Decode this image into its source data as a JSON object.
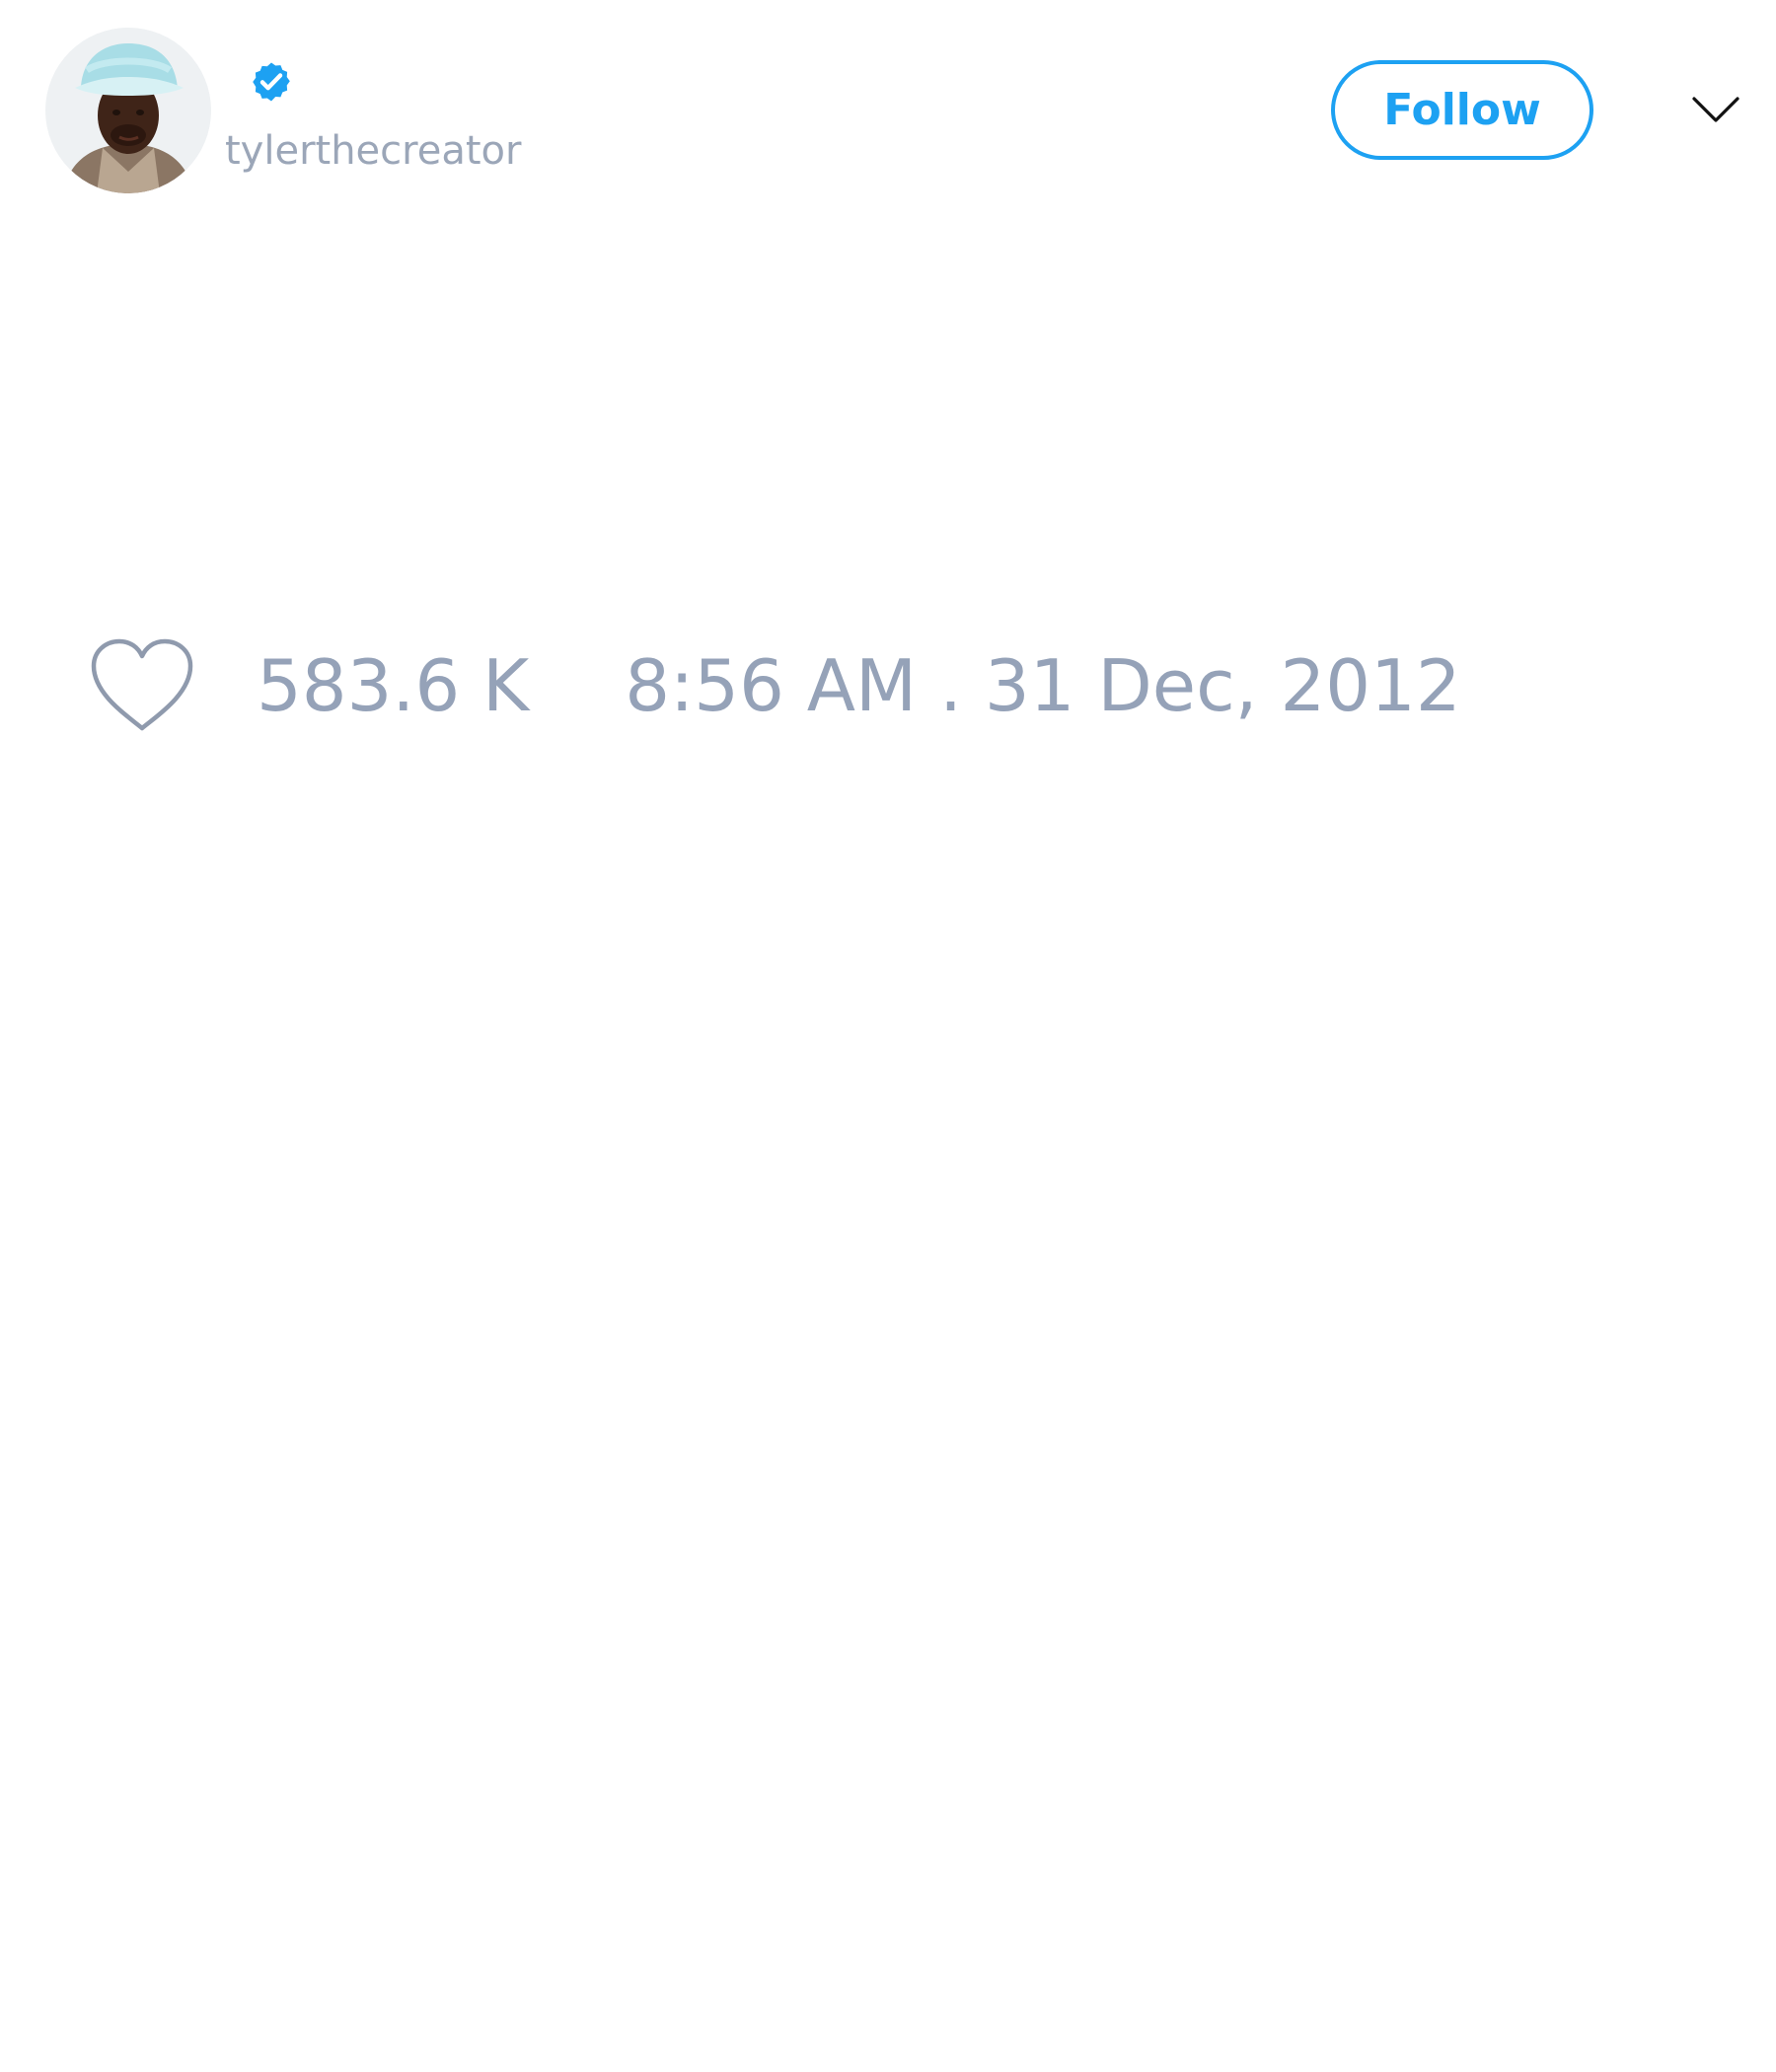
{
  "author": {
    "handle": "tylerthecreator",
    "verified": true,
    "avatar_icon": "profile-photo",
    "verified_icon": "verified-check-icon"
  },
  "actions": {
    "follow_label": "Follow",
    "more_icon": "chevron-down-icon"
  },
  "tweet": {
    "like_icon": "heart-outline-icon",
    "like_count": "583.6 K",
    "timestamp": "8:56 AM . 31 Dec, 2012"
  },
  "colors": {
    "accent": "#1da1f2",
    "muted_text": "#95a2b8",
    "background": "#ffffff"
  }
}
